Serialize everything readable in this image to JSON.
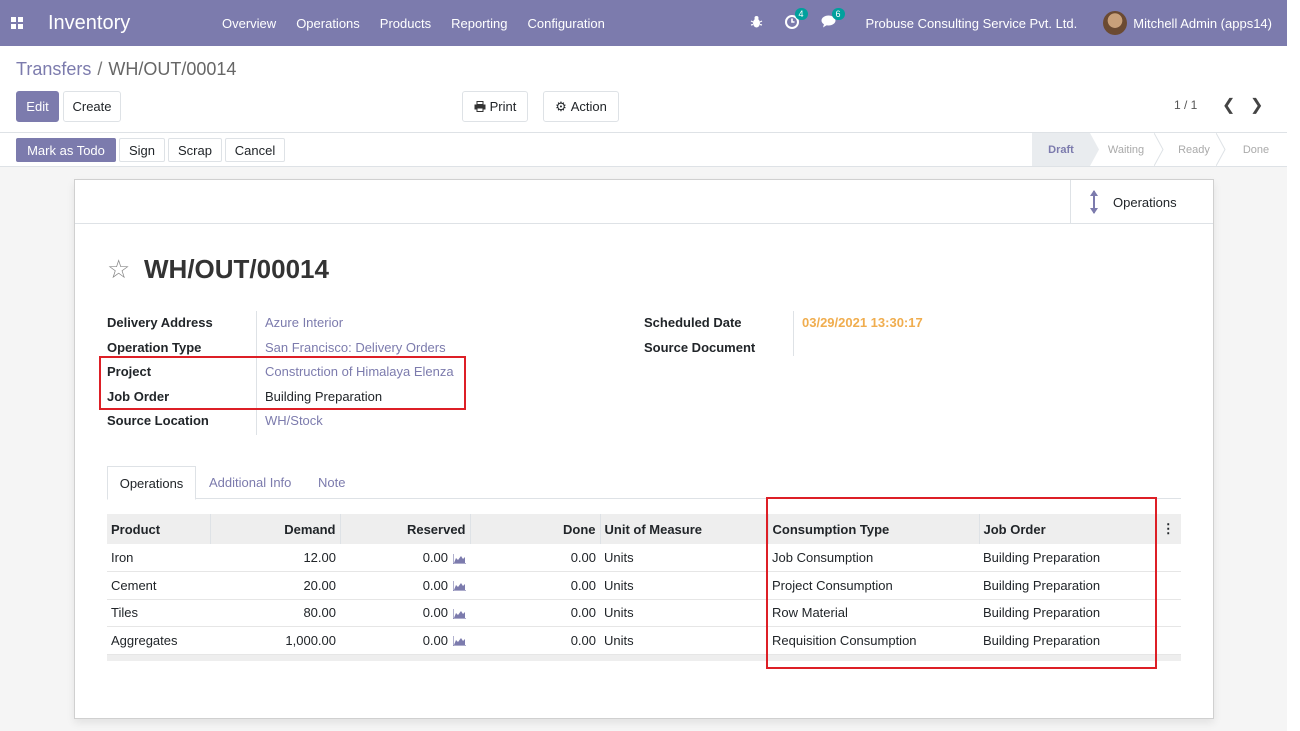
{
  "navbar": {
    "app_name": "Inventory",
    "menu": [
      "Overview",
      "Operations",
      "Products",
      "Reporting",
      "Configuration"
    ],
    "activity_count": "4",
    "message_count": "6",
    "company": "Probuse Consulting Service Pvt. Ltd.",
    "user": "Mitchell Admin (apps14)"
  },
  "breadcrumb": {
    "parent": "Transfers",
    "separator": "/",
    "current": "WH/OUT/00014"
  },
  "control": {
    "edit": "Edit",
    "create": "Create",
    "print": "Print",
    "action": "Action",
    "pager": "1 / 1"
  },
  "statusbar": {
    "buttons": [
      "Mark as Todo",
      "Sign",
      "Scrap",
      "Cancel"
    ],
    "stages": [
      "Draft",
      "Waiting",
      "Ready",
      "Done"
    ],
    "active_stage": "Draft"
  },
  "smart_button": {
    "label": "Operations"
  },
  "record": {
    "title": "WH/OUT/00014",
    "left_fields": [
      {
        "label": "Delivery Address",
        "value": "Azure Interior"
      },
      {
        "label": "Operation Type",
        "value": "San Francisco: Delivery Orders"
      },
      {
        "label": "Project",
        "value": "Construction of Himalaya Elenza"
      },
      {
        "label": "Job Order",
        "value": "Building Preparation"
      },
      {
        "label": "Source Location",
        "value": "WH/Stock"
      }
    ],
    "right_fields": [
      {
        "label": "Scheduled Date",
        "value": "03/29/2021 13:30:17"
      },
      {
        "label": "Source Document",
        "value": ""
      }
    ]
  },
  "tabs": [
    "Operations",
    "Additional Info",
    "Note"
  ],
  "table": {
    "columns": [
      "Product",
      "Demand",
      "Reserved",
      "Done",
      "Unit of Measure",
      "Consumption Type",
      "Job Order"
    ],
    "rows": [
      {
        "product": "Iron",
        "demand": "12.00",
        "reserved": "0.00",
        "done": "0.00",
        "uom": "Units",
        "consumption": "Job Consumption",
        "job_order": "Building Preparation"
      },
      {
        "product": "Cement",
        "demand": "20.00",
        "reserved": "0.00",
        "done": "0.00",
        "uom": "Units",
        "consumption": "Project Consumption",
        "job_order": "Building Preparation"
      },
      {
        "product": "Tiles",
        "demand": "80.00",
        "reserved": "0.00",
        "done": "0.00",
        "uom": "Units",
        "consumption": "Row Material",
        "job_order": "Building Preparation"
      },
      {
        "product": "Aggregates",
        "demand": "1,000.00",
        "reserved": "0.00",
        "done": "0.00",
        "uom": "Units",
        "consumption": "Requisition Consumption",
        "job_order": "Building Preparation"
      }
    ]
  },
  "colors": {
    "brand": "#7c7bad",
    "badge": "#00a09d",
    "highlight": "#dd1f26",
    "date": "#f0ad4e"
  }
}
